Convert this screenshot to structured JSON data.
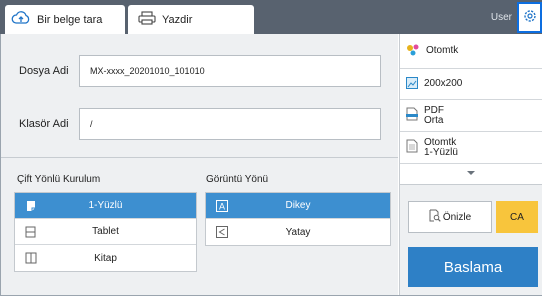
{
  "tabs": {
    "scan_label": "Bir belge tara",
    "print_label": "Yazdir"
  },
  "header": {
    "user_label": "User"
  },
  "form": {
    "filename_label": "Dosya Adi",
    "filename_value": "MX-xxxx_20201010_101010",
    "folder_label": "Klasör Adi",
    "folder_value": "/"
  },
  "duplex": {
    "title": "Çift Yönlü Kurulum",
    "options": [
      "1-Yüzlü",
      "Tablet",
      "Kitap"
    ],
    "selected": "1-Yüzlü"
  },
  "orientation": {
    "title": "Görüntü Yönü",
    "options": [
      "Dikey",
      "Yatay"
    ],
    "selected": "Dikey"
  },
  "side_panel": {
    "color_mode": "Otomtk",
    "resolution": "200x200",
    "format_line1": "PDF",
    "format_line2": "Orta",
    "original_line1": "Otomtk",
    "original_line2": "1-Yüzlü"
  },
  "actions": {
    "preview_label": "Önizle",
    "ca_label": "CA",
    "start_label": "Baslama"
  },
  "colors": {
    "topbar": "#58626f",
    "selected_option": "#3d8fd0",
    "start_button": "#2e80c6",
    "ca_button": "#f8c53c",
    "gear_highlight": "#0d6ee0"
  }
}
